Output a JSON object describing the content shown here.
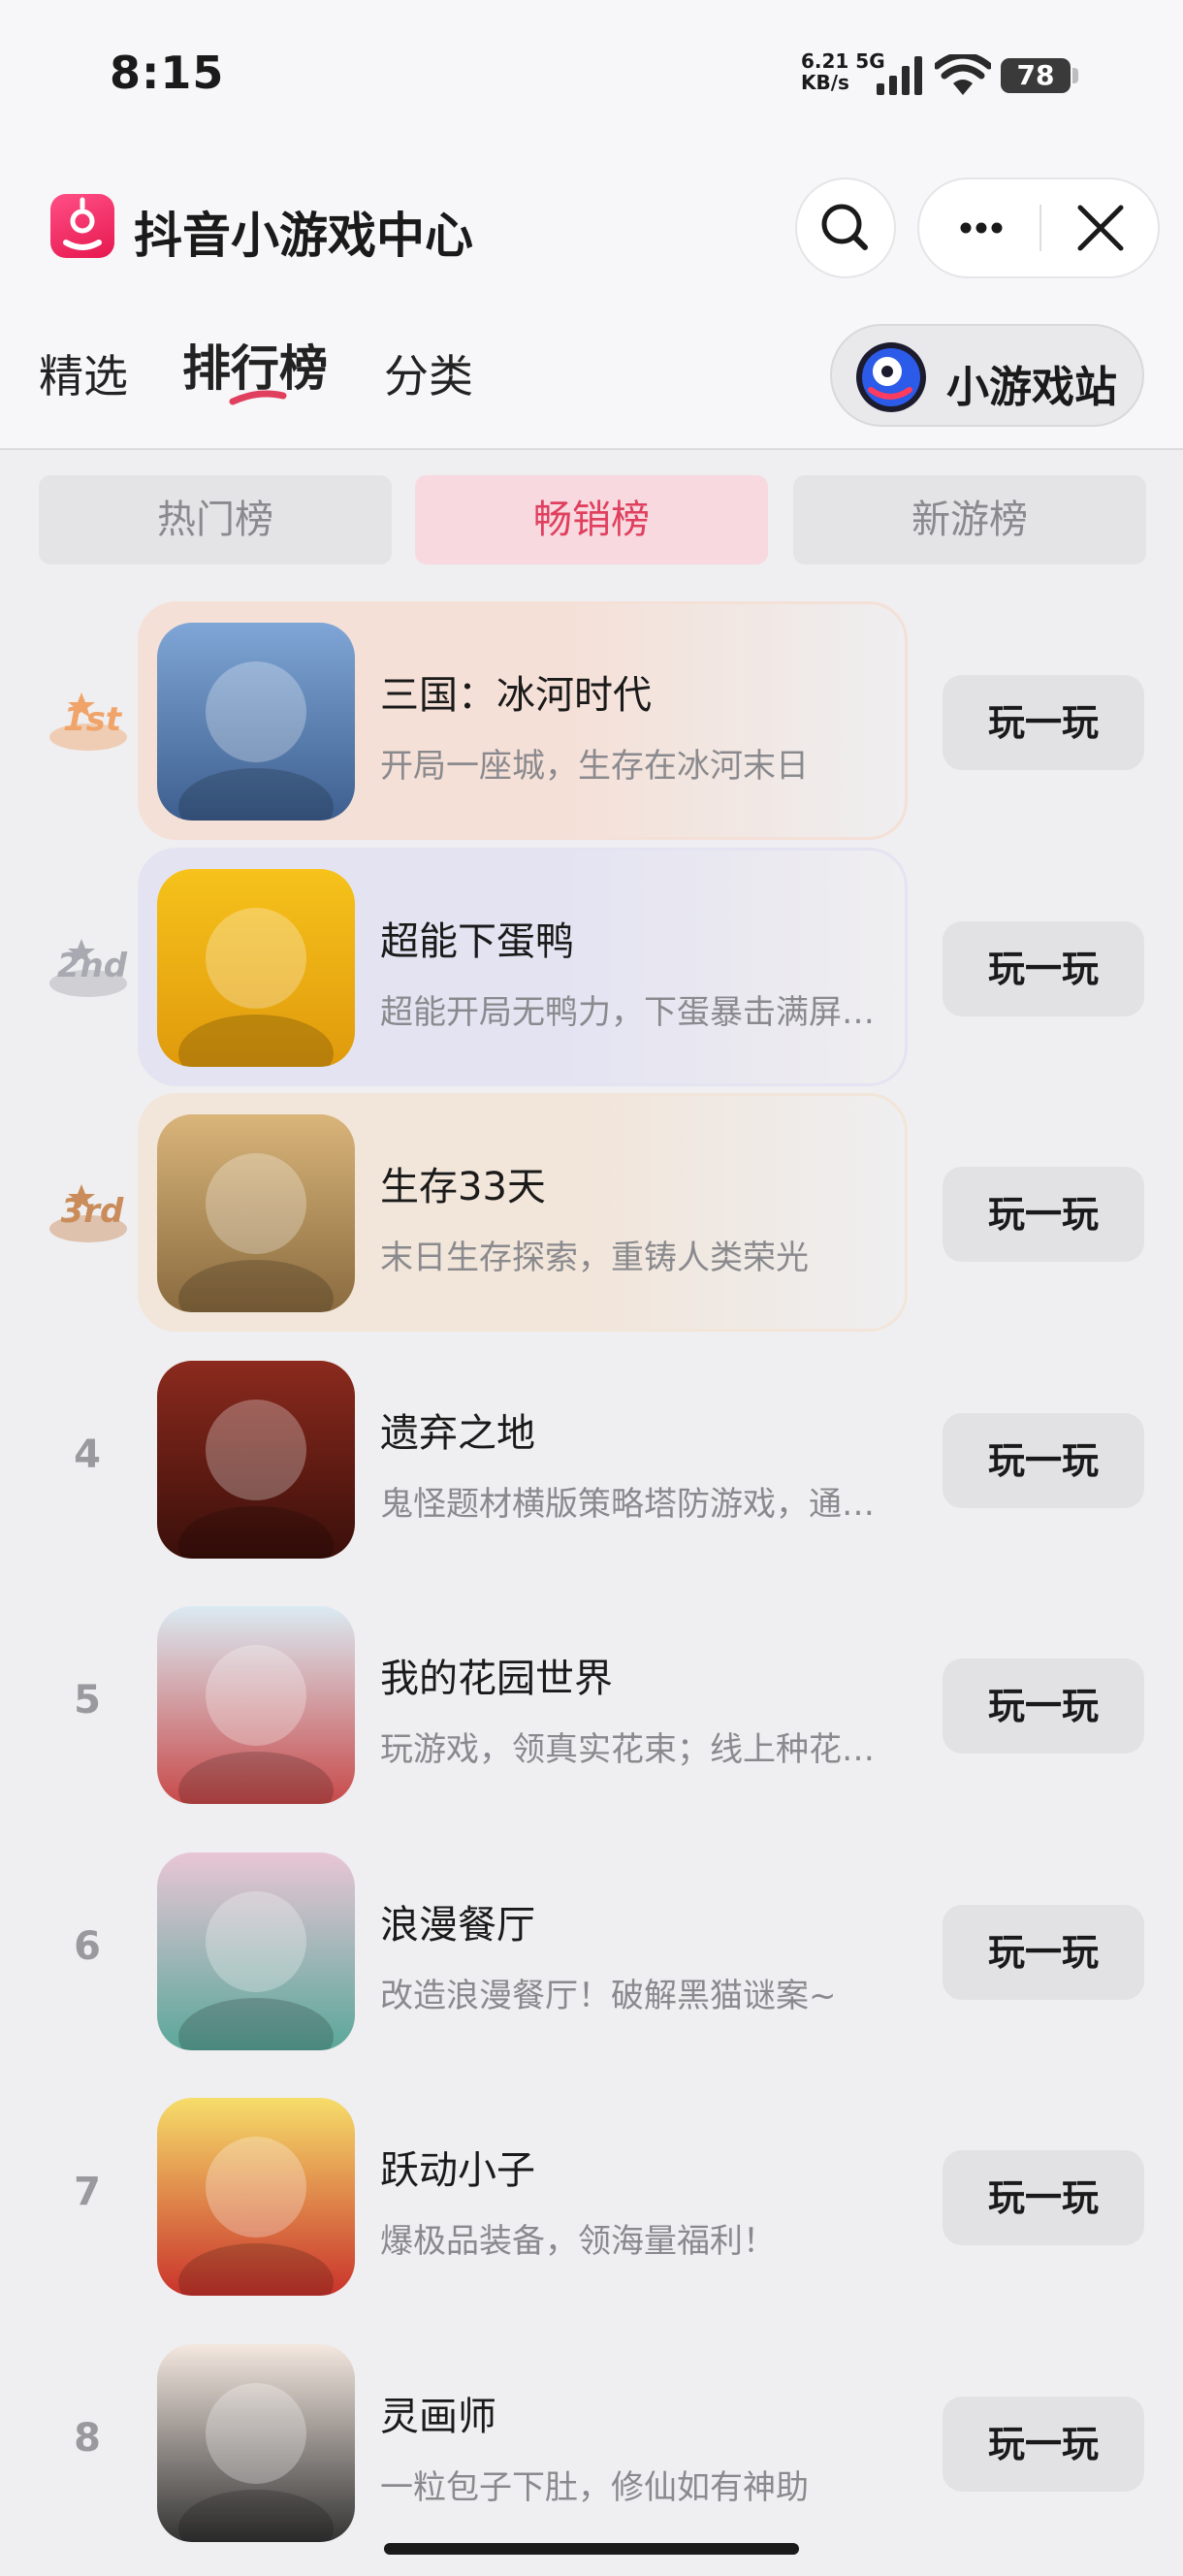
{
  "status_bar": {
    "time": "8:15",
    "net_speed_value": "6.21 5G",
    "net_speed_unit": "KB/s",
    "battery": "78"
  },
  "header": {
    "title": "抖音小游戏中心",
    "icons": {
      "search": "search-icon",
      "more": "more-dots-icon",
      "close": "close-icon"
    }
  },
  "tabs": [
    {
      "label": "精选"
    },
    {
      "label": "排行榜",
      "active": true
    },
    {
      "label": "分类"
    }
  ],
  "station_button": {
    "label": "小游戏站"
  },
  "sub_tabs": [
    {
      "label": "热门榜"
    },
    {
      "label": "畅销榜",
      "active": true
    },
    {
      "label": "新游榜"
    }
  ],
  "play_label": "玩一玩",
  "games": [
    {
      "rank": "1st",
      "name": "三国：冰河时代",
      "desc": "开局一座城，生存在冰河末日",
      "highlight": "#f6e0d6",
      "badge_color": "#f0a46a"
    },
    {
      "rank": "2nd",
      "name": "超能下蛋鸭",
      "desc": "超能开局无鸭力，下蛋暴击满屏金币！",
      "highlight": "#e4e3f3",
      "badge_color": "#a9a9b2"
    },
    {
      "rank": "3rd",
      "name": "生存33天",
      "desc": "末日生存探索，重铸人类荣光",
      "highlight": "#f3e5d8",
      "badge_color": "#c98c5a"
    },
    {
      "rank": "4",
      "name": "遗弃之地",
      "desc": "鬼怪题材横版策略塔防游戏，通关获得奖励"
    },
    {
      "rank": "5",
      "name": "我的花园世界",
      "desc": "玩游戏，领真实花束；线上种花线下收花"
    },
    {
      "rank": "6",
      "name": "浪漫餐厅",
      "desc": "改造浪漫餐厅！破解黑猫谜案~"
    },
    {
      "rank": "7",
      "name": "跃动小子",
      "desc": "爆极品装备，领海量福利！"
    },
    {
      "rank": "8",
      "name": "灵画师",
      "desc": "一粒包子下肚，修仙如有神助"
    }
  ]
}
